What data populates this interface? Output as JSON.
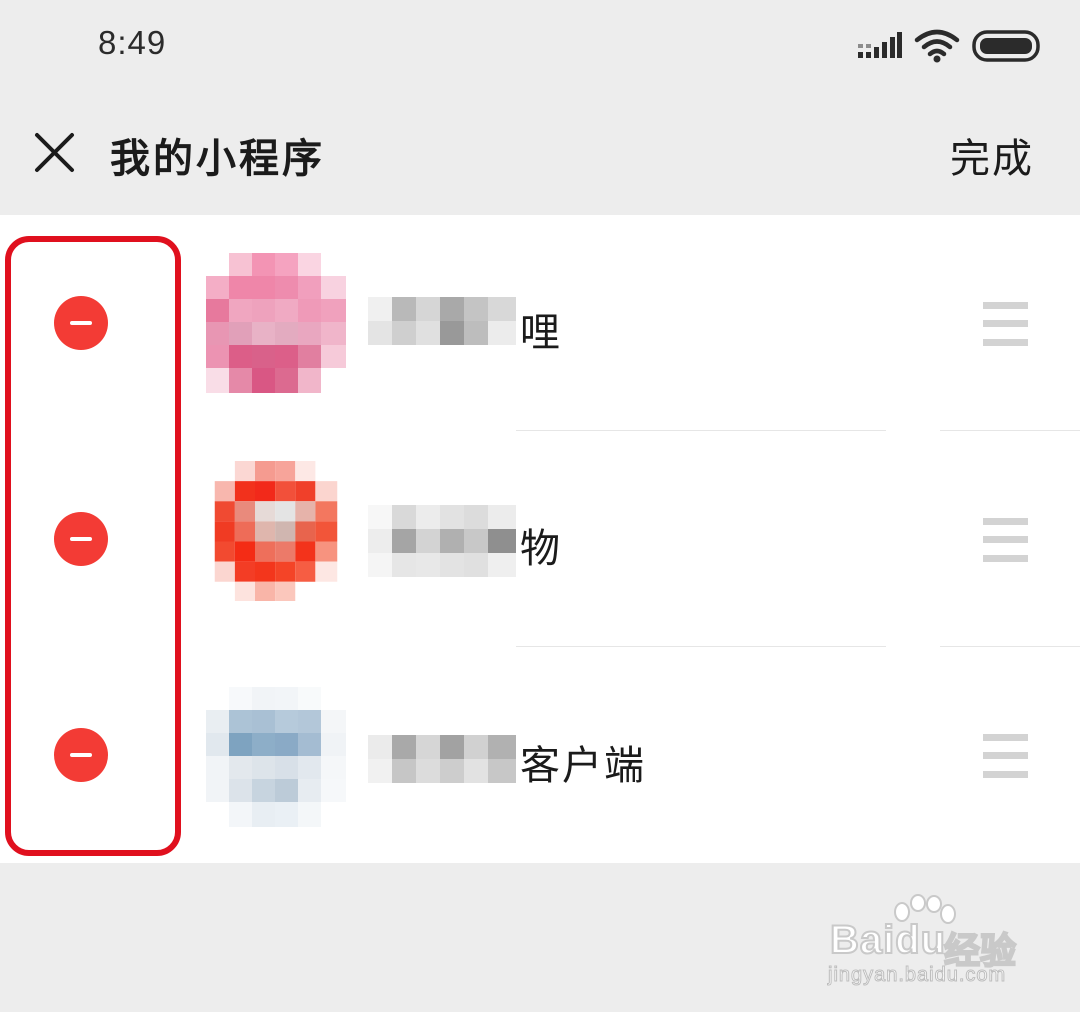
{
  "status_bar": {
    "time": "8:49",
    "icons": [
      "signal-icon",
      "wifi-icon",
      "battery-icon"
    ]
  },
  "header": {
    "close_icon": "close-icon",
    "title": "我的小程序",
    "done_label": "完成"
  },
  "list": {
    "items": [
      {
        "label_visible": "哩",
        "name_obscured": true,
        "avatar": "pixelated-pink-icon",
        "remove_icon": "minus-circle-icon",
        "drag_icon": "drag-handle-icon"
      },
      {
        "label_visible": "物",
        "name_obscured": true,
        "avatar": "pixelated-red-icon",
        "remove_icon": "minus-circle-icon",
        "drag_icon": "drag-handle-icon"
      },
      {
        "label_visible": "客户端",
        "name_obscured": true,
        "avatar": "pixelated-blue-icon",
        "remove_icon": "minus-circle-icon",
        "drag_icon": "drag-handle-icon"
      }
    ]
  },
  "highlight": {
    "color": "#e0101e"
  },
  "watermark": {
    "brand": "Baidu",
    "suffix": "经验",
    "url": "jingyan.baidu.com"
  },
  "colors": {
    "background": "#ededed",
    "list_background": "#ffffff",
    "remove_button": "#f33b35",
    "text": "#1b1b1b",
    "drag_handle": "#d3d3d3"
  }
}
